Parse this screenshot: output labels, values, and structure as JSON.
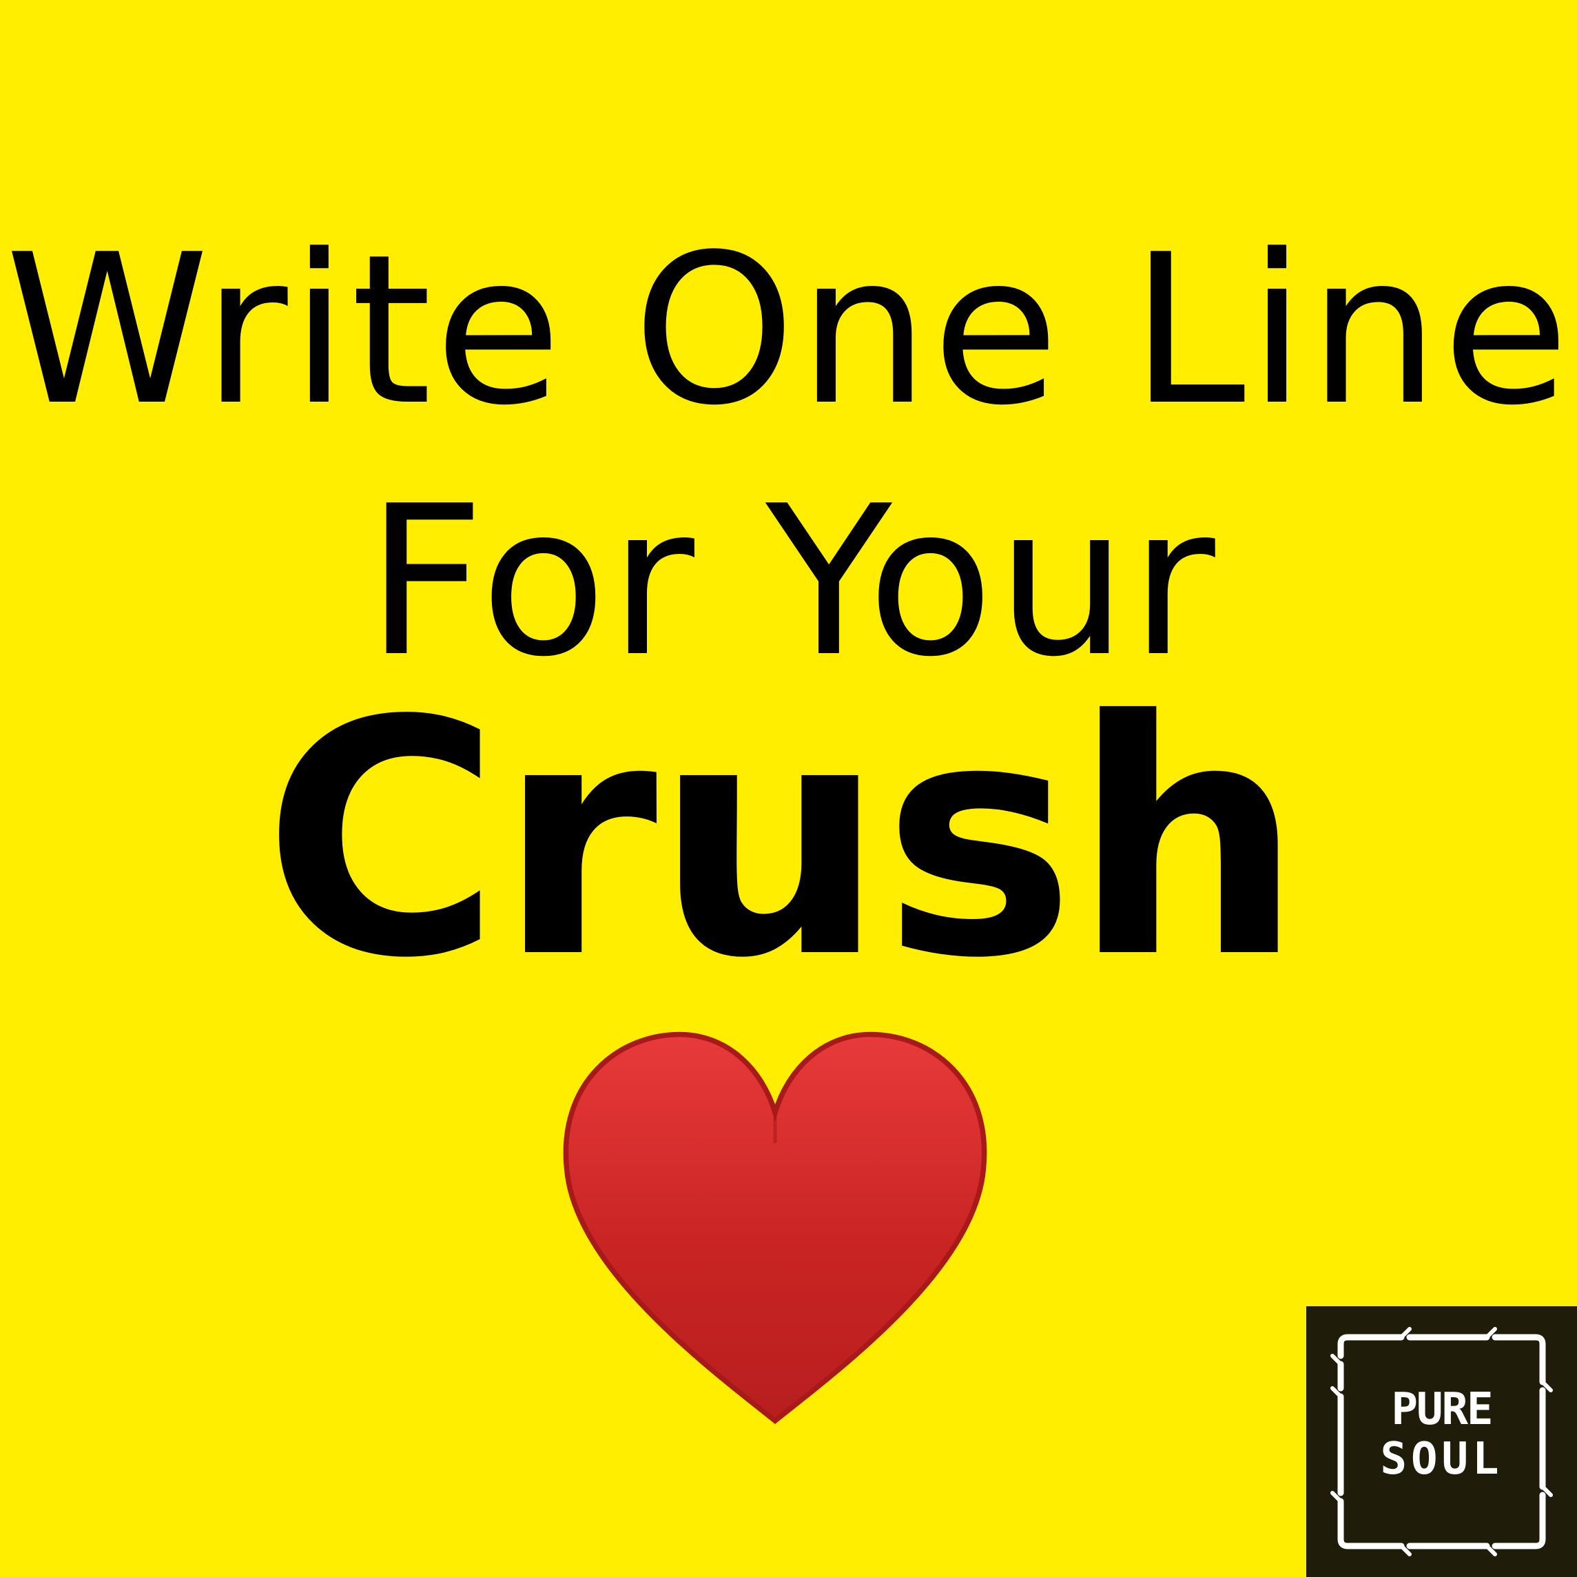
{
  "background_color": "#FFEE00",
  "text_color": "#000000",
  "headline": {
    "line1": "Write One Line",
    "line2": "For Your",
    "line3": "Crush"
  },
  "heart": {
    "icon": "red-heart-emoji",
    "color": "#D42A28"
  },
  "logo": {
    "background_color": "#1F1C0A",
    "line1": "PURE",
    "line2": "SOUL"
  }
}
